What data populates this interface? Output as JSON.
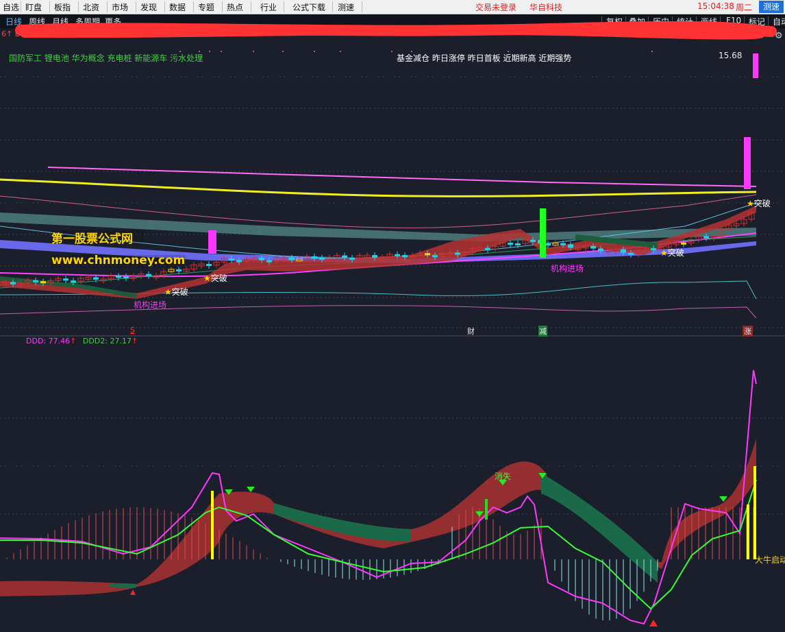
{
  "menu": {
    "items": [
      "自选",
      "盯盘",
      "板指",
      "北资",
      "市场",
      "发现",
      "数据",
      "专题",
      "热点",
      "行业",
      "公式下载",
      "测速"
    ],
    "login_status": "交易未登录",
    "broker": "华自科技",
    "time": "15:04:38",
    "weekday": "周二",
    "speed_button": "测速"
  },
  "toolbar": {
    "periods": [
      "日线",
      "周线",
      "月线",
      "多周期",
      "更多"
    ],
    "active_period": "日线",
    "actions": [
      "复权",
      "叠加",
      "历史",
      "统计",
      "画线",
      "F10",
      "标记",
      "自动"
    ],
    "gear_icon": "gear-icon"
  },
  "info_prefix": "6↑ E",
  "main_chart": {
    "concepts": "国防军工 锂电池 华为概念 充电桩 新能源车 污水处理",
    "tags": "基金减仓 昨日涨停 昨日首板 近期新高 近期强势",
    "last_price": "15.68",
    "watermark_title": "第一股票公式网",
    "watermark_url": "www.chnmoney.com",
    "annotations": {
      "breakout": "突破",
      "institution_entry": "机构进场",
      "markers": [
        "S",
        "财",
        "减",
        "涨"
      ]
    },
    "colors": {
      "up": "#c83232",
      "down": "#22d3e8",
      "yellow": "#ffd400",
      "magenta": "#ff38ff",
      "green": "#22ff22"
    }
  },
  "sub_chart": {
    "ddd_label": "DDD:",
    "ddd_value": "77.46",
    "ddd2_label": "DDD2:",
    "ddd2_value": "27.17",
    "arrow": "↑",
    "texts": {
      "vanish": "消失",
      "bull_start": "大牛启动"
    }
  }
}
